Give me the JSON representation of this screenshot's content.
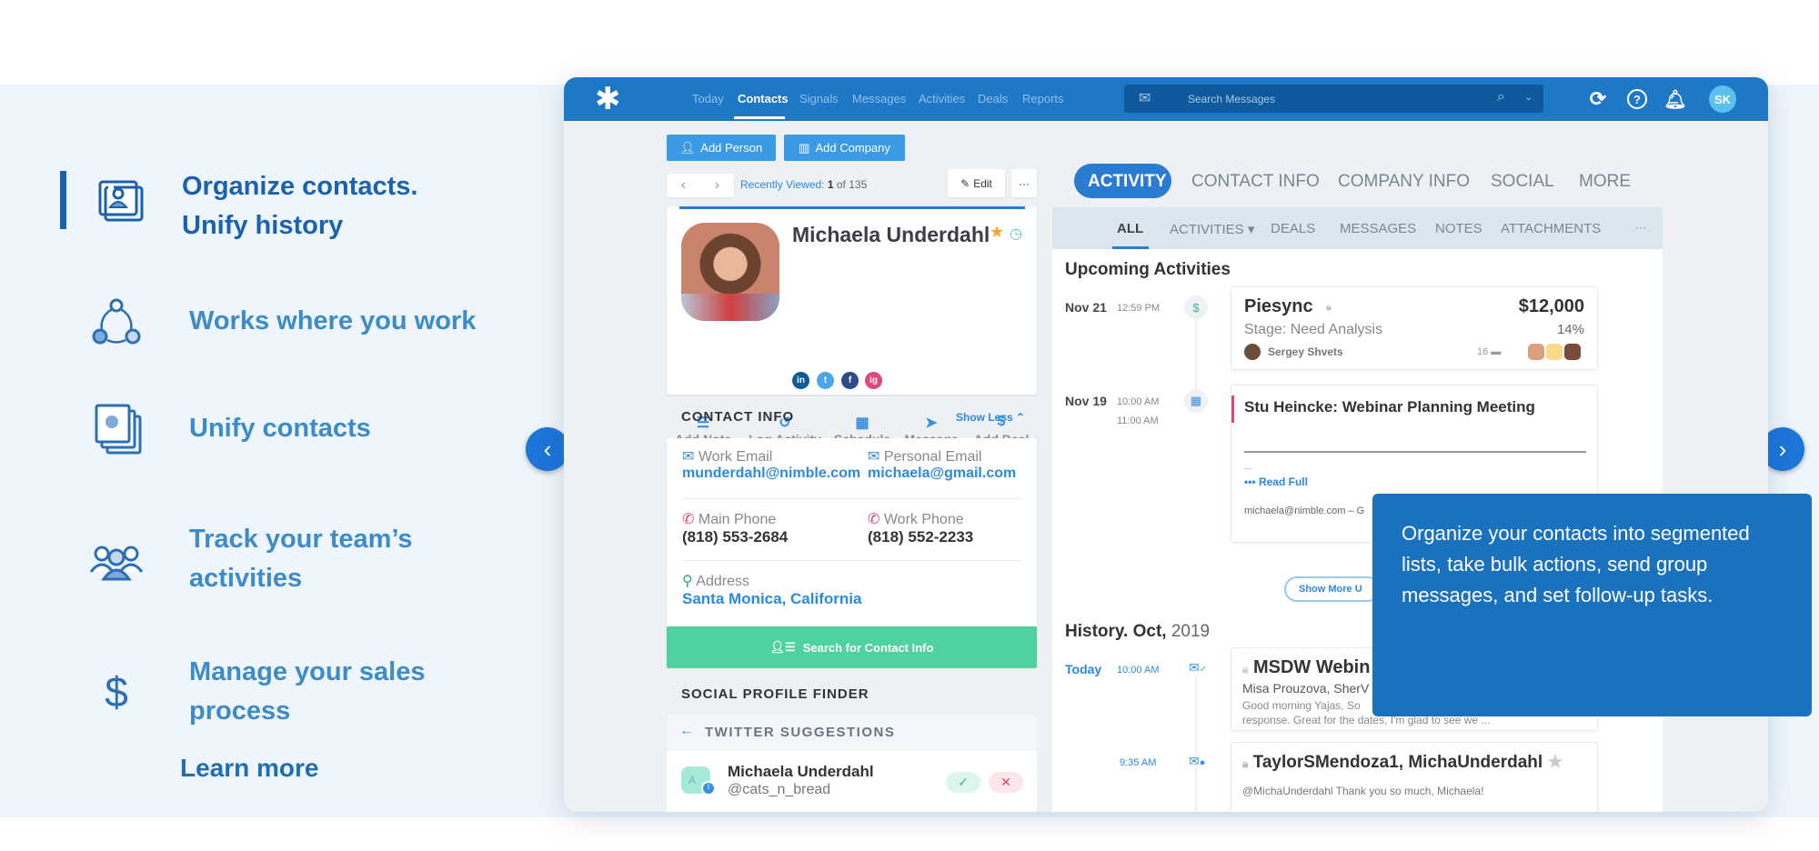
{
  "features": [
    {
      "label_lines": [
        "Organize contacts.",
        "Unify history"
      ],
      "icon": "contact-card-icon",
      "selected": true
    },
    {
      "label_lines": [
        "Works where you work"
      ],
      "icon": "network-icon"
    },
    {
      "label_lines": [
        "Unify contacts"
      ],
      "icon": "stacked-cards-icon"
    },
    {
      "label_lines": [
        "Track your team’s",
        "activities"
      ],
      "icon": "team-icon"
    },
    {
      "label_lines": [
        "Manage your sales",
        "process"
      ],
      "icon": "dollar-icon"
    }
  ],
  "learn_more": "Learn more",
  "tooltip": "Organize your contacts into segmented lists, take bulk actions, send group messages, and set follow-up tasks.",
  "colors": {
    "brand": "#1e78c6",
    "accent_green": "#4fd1a0",
    "tooltip": "#1a72bf",
    "feature_text": "#3d8bc7",
    "feature_selected": "#1a62ad"
  },
  "app": {
    "nav": [
      "Today",
      "Contacts",
      "Signals",
      "Messages",
      "Activities",
      "Deals",
      "Reports"
    ],
    "nav_active": "Contacts",
    "search_placeholder": "Search Messages",
    "avatar_initials": "SK",
    "add_person": "Add Person",
    "add_company": "Add Company",
    "recently_viewed_label": "Recently Viewed:",
    "recently_viewed_pos": "1",
    "recently_viewed_of": "of 135",
    "edit": "Edit",
    "more_dots": "···",
    "tabs": [
      "ACTIVITY",
      "CONTACT INFO",
      "COMPANY INFO",
      "SOCIAL",
      "MORE"
    ],
    "subtabs": [
      "ALL",
      "ACTIVITIES ▾",
      "DEALS",
      "MESSAGES",
      "NOTES",
      "ATTACHMENTS",
      "···"
    ],
    "contact": {
      "name": "Michaela Underdahl",
      "socials": [
        "in",
        "t",
        "f",
        "ig"
      ],
      "actions": [
        {
          "label": "Add Note",
          "icon": "note-icon",
          "glyph": "☰"
        },
        {
          "label": "Log Activity",
          "icon": "history-icon",
          "glyph": "↺"
        },
        {
          "label": "Schedule",
          "icon": "calendar-icon",
          "glyph": "▦"
        },
        {
          "label": "Message",
          "icon": "send-icon",
          "glyph": "➤"
        },
        {
          "label": "Add Deal",
          "icon": "dollar-icon",
          "glyph": "$"
        }
      ]
    },
    "contact_info": {
      "title": "CONTACT INFO",
      "show_less": "Show Less ⌃",
      "work_email_label": "Work Email",
      "work_email": "munderdahl@nimble.com",
      "personal_email_label": "Personal Email",
      "personal_email": "michaela@gmail.com",
      "main_phone_label": "Main Phone",
      "main_phone": "(818) 553-2684",
      "work_phone_label": "Work Phone",
      "work_phone": "(818) 552-2233",
      "address_label": "Address",
      "address": "Santa Monica, California",
      "search_button": "Search for Contact Info"
    },
    "social_finder": {
      "title": "SOCIAL PROFILE FINDER",
      "band": "TWITTER SUGGESTIONS",
      "name": "Michaela Underdahl",
      "handle": "@cats_n_bread",
      "avatar_letter": "A"
    },
    "upcoming": {
      "title": "Upcoming Activities",
      "items": [
        {
          "date": "Nov 21",
          "time": "12:59 PM",
          "title": "Piesync",
          "amount": "$12,000",
          "stage": "Stage: Need Analysis",
          "percent": "14%",
          "owner": "Sergey Shvets",
          "count": "16"
        },
        {
          "date": "Nov 19",
          "time": "10:00 AM",
          "time_end": "11:00 AM",
          "title": "Stu Heincke: Webinar Planning Meeting",
          "ellipsis": "...",
          "read_full": "Read Full",
          "footer": "michaela@nimble.com – G"
        }
      ],
      "show_more": "Show  More U"
    },
    "history": {
      "title": "History. Oct,",
      "year": "2019",
      "items": [
        {
          "date": "Today",
          "time": "10:00 AM",
          "title": "MSDW Webin",
          "people": "Misa Prouzova, SherV",
          "snippet1": "Good morning Yajas, So",
          "snippet2": "response. Great for the dates, I'm glad to see we ..."
        },
        {
          "time": "9:35 AM",
          "title": "TaylorSMendoza1, MichaUnderdahl",
          "snippet1": "@MichaUnderdahl Thank you so much, Michaela!"
        }
      ]
    }
  }
}
